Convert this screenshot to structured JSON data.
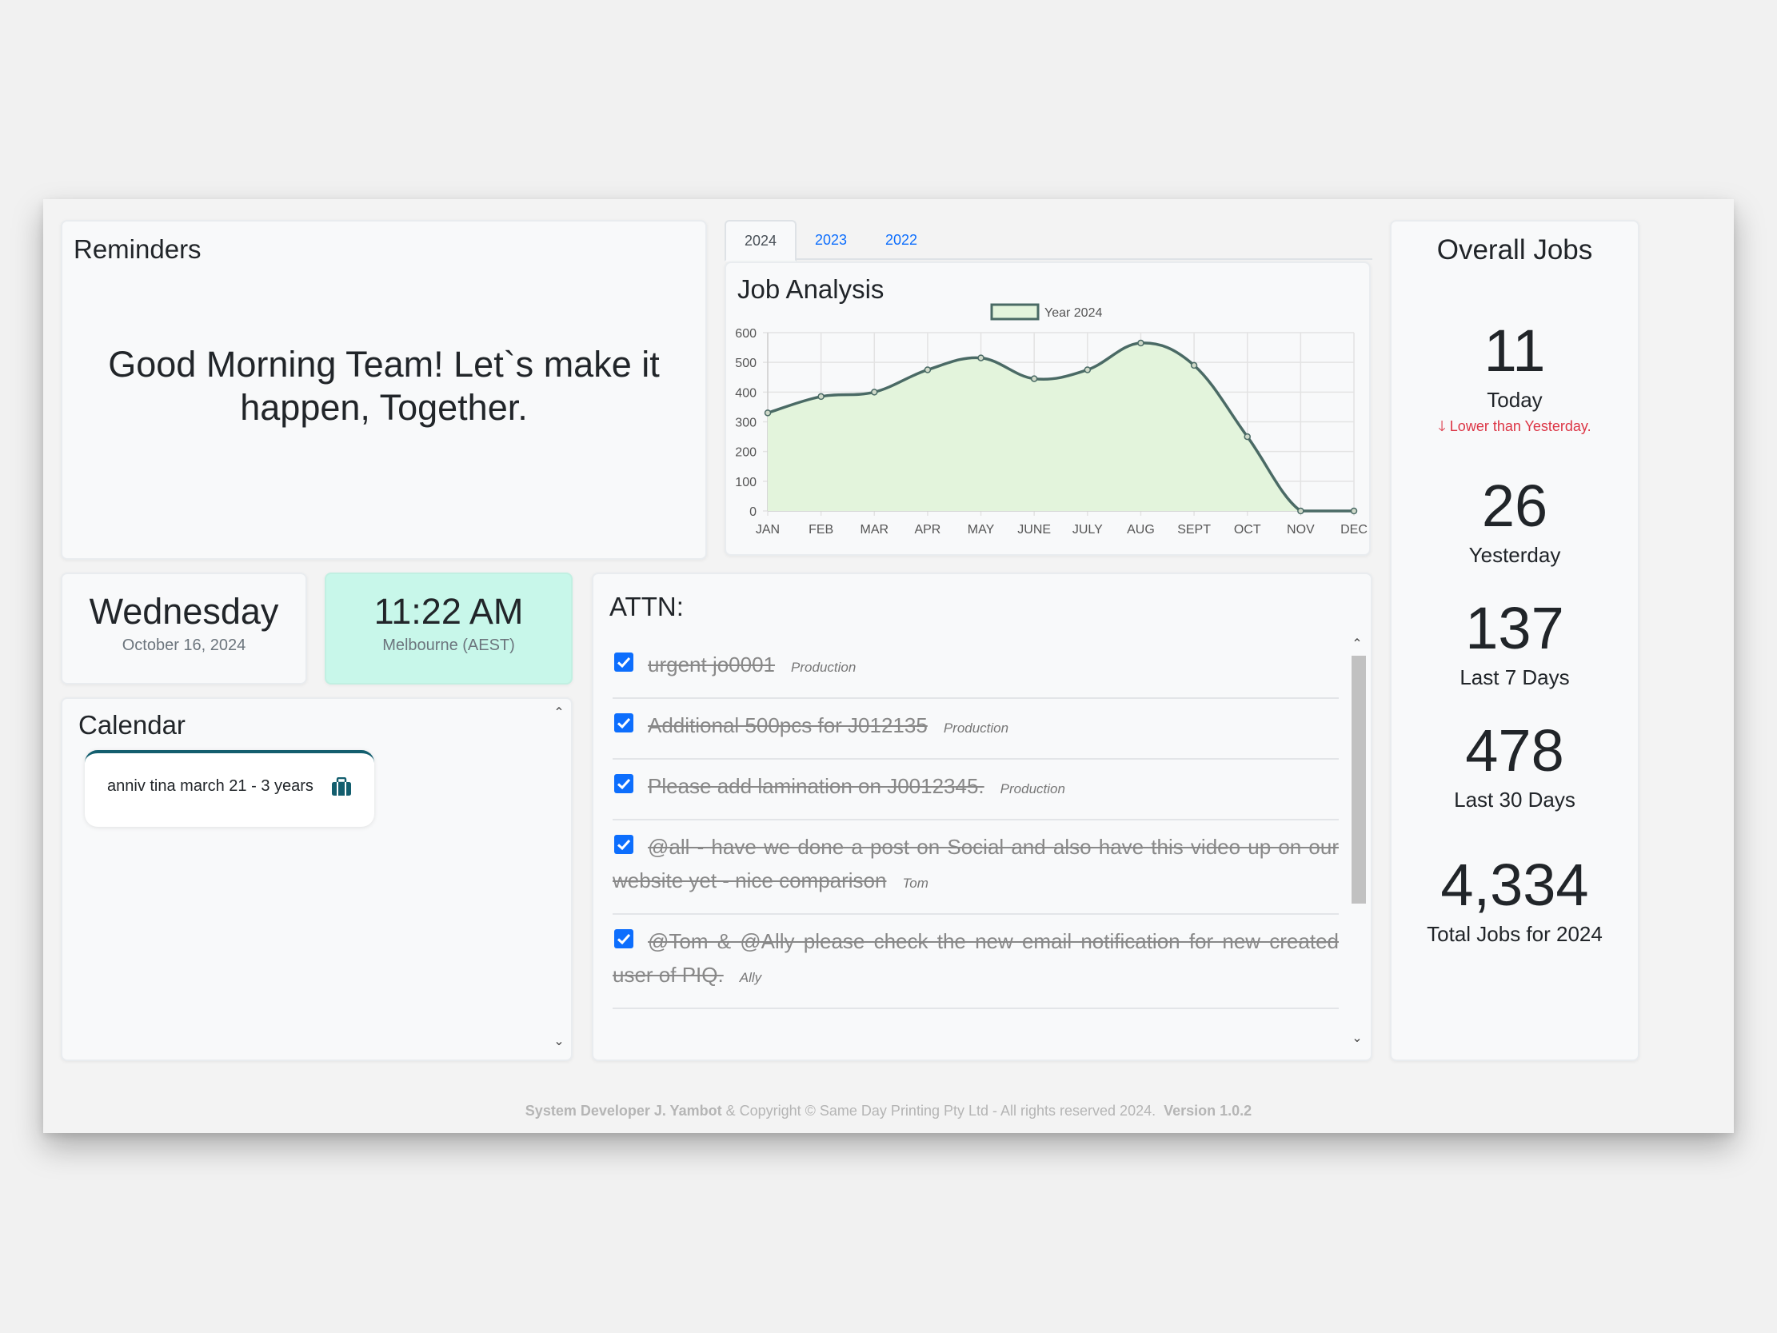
{
  "reminders": {
    "title": "Reminders",
    "message": "Good Morning Team! Let`s make it happen, Together."
  },
  "tabs": [
    {
      "label": "2024",
      "active": true
    },
    {
      "label": "2023",
      "active": false
    },
    {
      "label": "2022",
      "active": false
    }
  ],
  "job_analysis": {
    "title": "Job Analysis"
  },
  "chart_data": {
    "type": "area",
    "title": "Job Analysis",
    "categories": [
      "JAN",
      "FEB",
      "MAR",
      "APR",
      "MAY",
      "JUNE",
      "JULY",
      "AUG",
      "SEPT",
      "OCT",
      "NOV",
      "DEC"
    ],
    "series": [
      {
        "name": "Year 2024",
        "values": [
          330,
          385,
          400,
          475,
          515,
          445,
          475,
          565,
          490,
          250,
          0,
          0
        ],
        "color": "#4a6a65",
        "fill": "#e3f4dc"
      }
    ],
    "ylim": [
      0,
      600
    ],
    "yticks": [
      0,
      100,
      200,
      300,
      400,
      500,
      600
    ],
    "grid": true,
    "legend": "top-center"
  },
  "overall_jobs": {
    "title": "Overall Jobs",
    "today": {
      "value": "11",
      "label": "Today",
      "trend": "Lower than Yesterday."
    },
    "yesterday": {
      "value": "26",
      "label": "Yesterday"
    },
    "last7": {
      "value": "137",
      "label": "Last 7 Days"
    },
    "last30": {
      "value": "478",
      "label": "Last 30 Days"
    },
    "total": {
      "value": "4,334",
      "label": "Total Jobs for 2024"
    }
  },
  "day": {
    "name": "Wednesday",
    "date": "October 16, 2024"
  },
  "time": {
    "value": "11:22 AM",
    "zone": "Melbourne (AEST)"
  },
  "calendar": {
    "title": "Calendar",
    "events": [
      {
        "text": "anniv tina march 21 - 3 years",
        "icon": "briefcase-icon"
      }
    ]
  },
  "attn": {
    "title": "ATTN:",
    "items": [
      {
        "text": "urgent jo0001",
        "author": "Production",
        "checked": true
      },
      {
        "text": "Additional 500pcs for J012135",
        "author": "Production",
        "checked": true
      },
      {
        "text": "Please add lamination on J0012345.",
        "author": "Production",
        "checked": true
      },
      {
        "text": "@all - have we done a post on Social and also have this video up on our website yet - nice comparison",
        "author": "Tom",
        "checked": true
      },
      {
        "text": "@Tom & @Ally please check the new email notification for new created user of PIQ.",
        "author": "Ally",
        "checked": true
      }
    ]
  },
  "footer": {
    "developer": "System Developer J. Yambot",
    "copyright": "& Copyright © Same Day Printing Pty Ltd - All rights reserved 2024.",
    "version": "Version 1.0.2"
  },
  "colors": {
    "accent": "#0d6efd",
    "time_card": "#c8f7ea",
    "series_line": "#4a6a65",
    "series_fill": "#e3f4dc",
    "trend_down": "#dc3545",
    "calendar_accent": "#135e6e"
  }
}
